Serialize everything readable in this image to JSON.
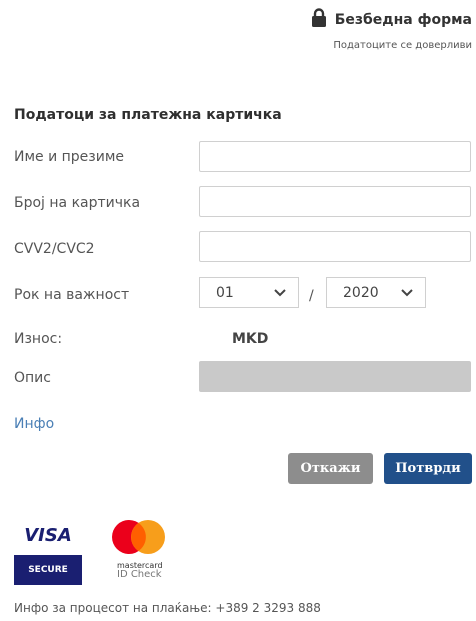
{
  "header": {
    "title": "Безбедна форма",
    "subtitle": "Податоците се доверливи"
  },
  "section_title": "Податоци за платежна картичка",
  "form": {
    "name_label": "Име и презиме",
    "card_number_label": "Број на картичка",
    "cvv_label": "CVV2/CVC2",
    "expiry_label": "Рок на важност",
    "expiry_month": "01",
    "expiry_separator": "/",
    "expiry_year": "2020",
    "amount_label": "Износ:",
    "amount_currency": "MKD",
    "description_label": "Опис"
  },
  "info_link": "Инфо",
  "buttons": {
    "cancel": "Откажи",
    "confirm": "Потврди"
  },
  "logos": {
    "visa_text": "VISA",
    "visa_secure": "SECURE",
    "mastercard_line1": "mastercard",
    "mastercard_line2": "ID Check"
  },
  "footer": "Инфо за процесот на плаќање: +389 2 3293 888",
  "colors": {
    "primary": "#21508a",
    "cancel": "#8d8d8d",
    "link": "#4a7fb5",
    "disabled_field": "#c9c9c9"
  }
}
